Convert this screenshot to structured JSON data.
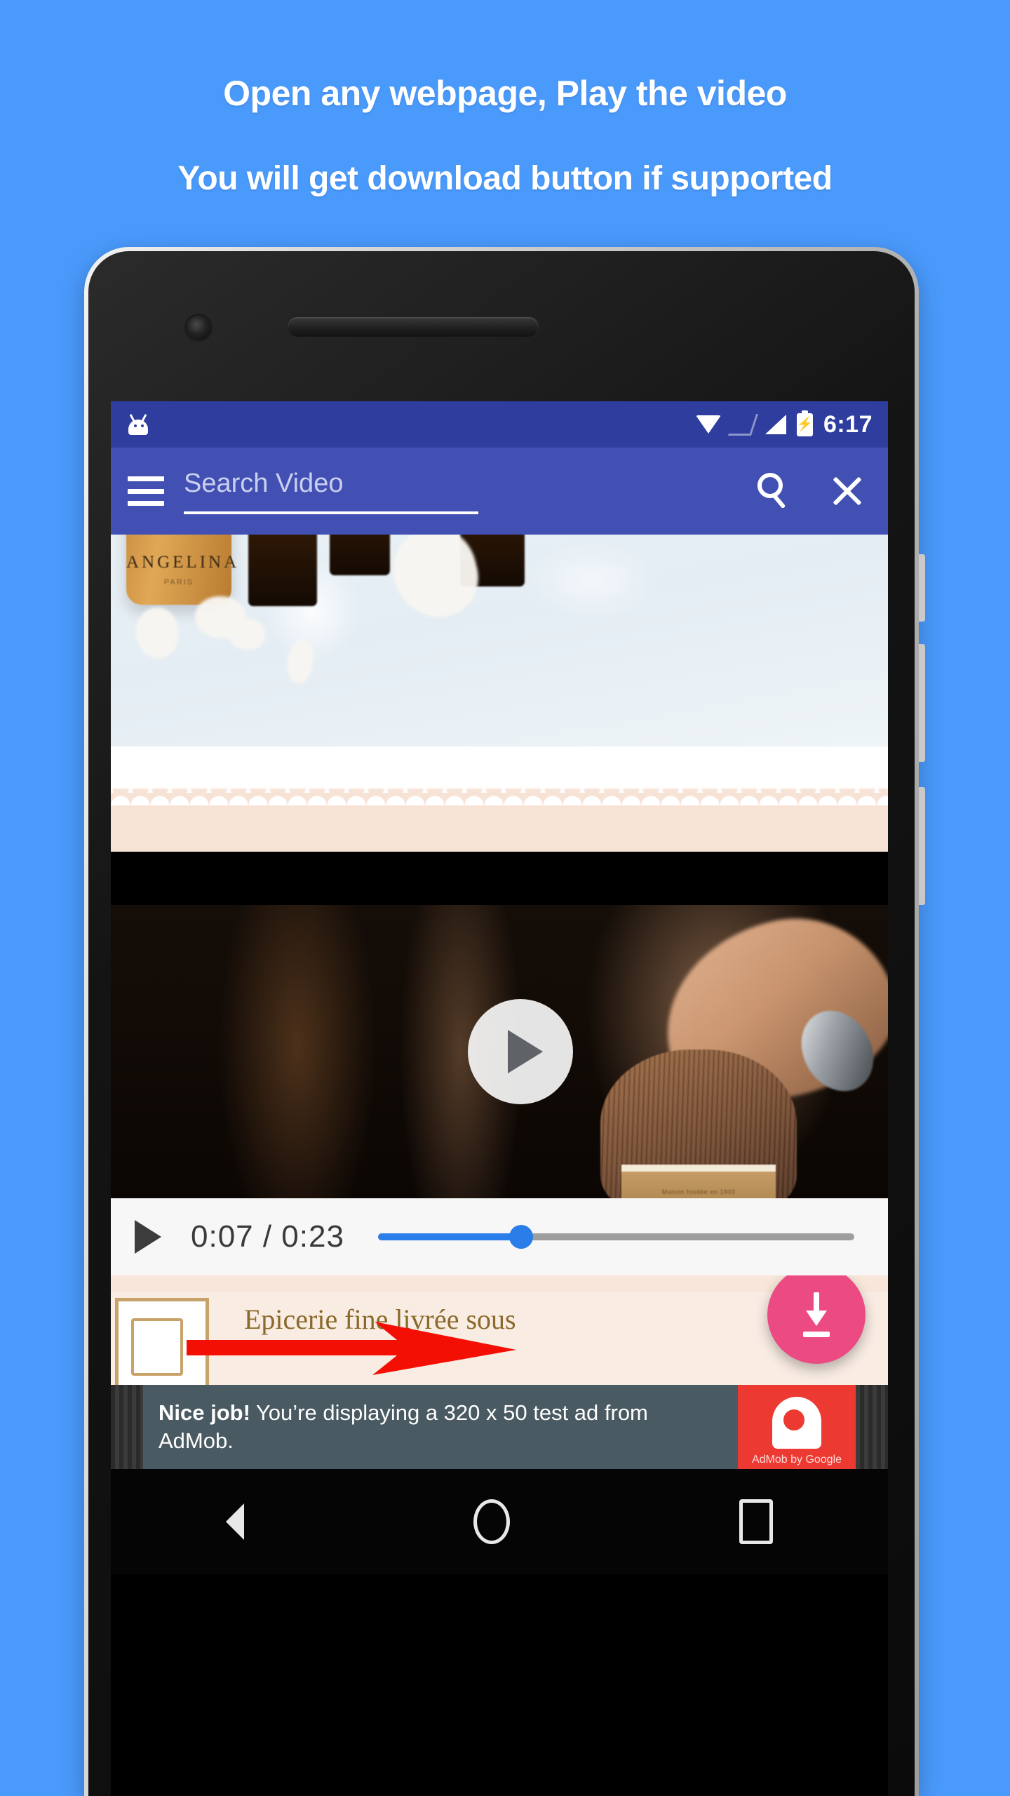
{
  "headline": {
    "line1": "Open any webpage, Play the video",
    "line2": "You will get download button if supported"
  },
  "colors": {
    "background": "#4a9afc",
    "status_bar": "#2f3e9e",
    "app_bar": "#4350b3",
    "fab": "#ec4a83",
    "seek_fill": "#2b7de9",
    "arrow": "#f40f04",
    "admob_red": "#ec3a33",
    "admob_body": "#4a5a62"
  },
  "status_bar": {
    "app_icon": "android-robot-icon",
    "icons": [
      "wifi-icon",
      "signal-empty-icon",
      "signal-full-icon",
      "battery-charging-icon"
    ],
    "time": "6:17"
  },
  "app_bar": {
    "menu_icon": "hamburger-menu-icon",
    "search_placeholder": "Search Video",
    "search_value": "",
    "search_icon": "search-icon",
    "close_icon": "close-icon"
  },
  "page_content": {
    "product_label": "ANGELINA",
    "product_sublabel": "PARIS",
    "french_text": "Epicerie fine livrée sous",
    "cup_text": "Maison fondée en 1903"
  },
  "video": {
    "play_overlay_icon": "play-circle-icon",
    "play_button_icon": "play-icon",
    "current_time": "0:07",
    "duration": "0:23",
    "time_display": "0:07 / 0:23",
    "progress_percent": 30
  },
  "download": {
    "fab_icon": "download-icon",
    "pointer_icon": "right-arrow-icon"
  },
  "ad": {
    "headline": "Nice job!",
    "body": " You’re displaying a 320 x 50 test ad from AdMob.",
    "logo_caption": "AdMob by Google"
  },
  "nav_bar": {
    "back_icon": "back-triangle-icon",
    "home_icon": "home-circle-icon",
    "recents_icon": "recents-square-icon"
  }
}
